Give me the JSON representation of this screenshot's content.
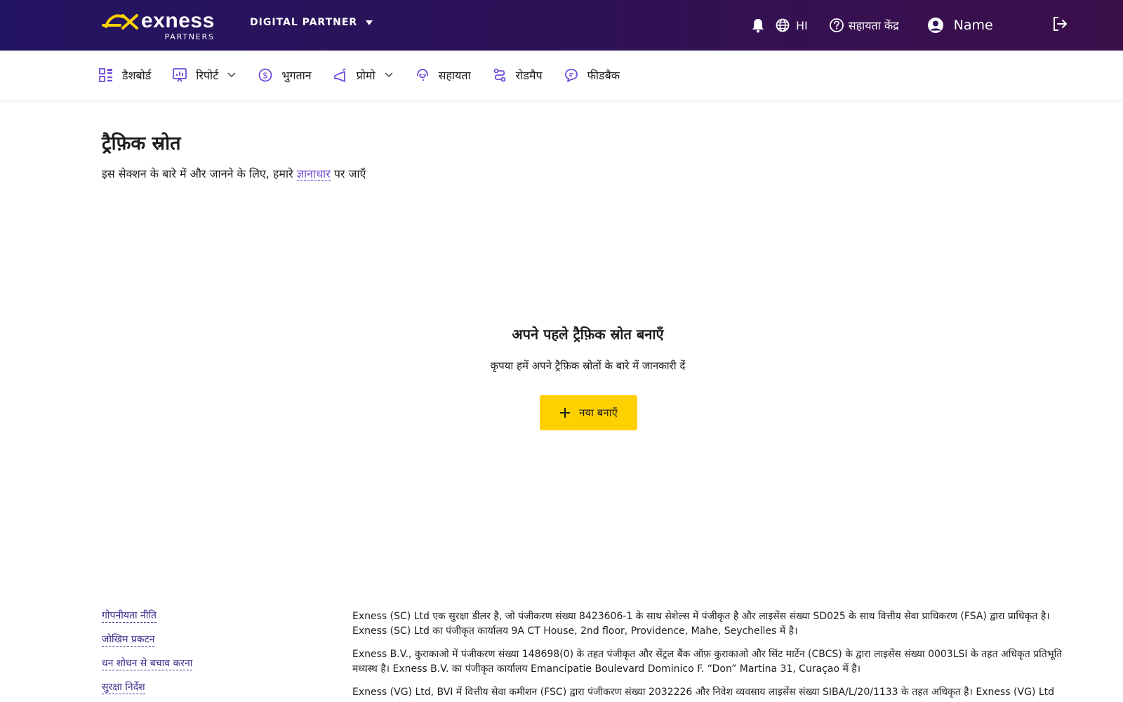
{
  "header": {
    "logo_word": "exness",
    "logo_sub": "PARTNERS",
    "partner_type": "DIGITAL PARTNER",
    "language": "HI",
    "help_center": "सहायता केंद्र",
    "user_name": "Name",
    "colors": {
      "accent": "#ffd000",
      "header_start": "#231462",
      "header_end": "#3b0f4a",
      "logo_mark": "#ffd000"
    }
  },
  "nav": {
    "items": [
      {
        "icon": "dashboard-icon",
        "label": "डैशबोर्ड"
      },
      {
        "icon": "report-icon",
        "label": "रिपोर्ट"
      },
      {
        "icon": "payment-icon",
        "label": "भुगतान"
      },
      {
        "icon": "promo-icon",
        "label": "प्रोमो"
      },
      {
        "icon": "support-icon",
        "label": "सहायता"
      },
      {
        "icon": "roadmap-icon",
        "label": "रोडमैप"
      },
      {
        "icon": "feedback-icon",
        "label": "फीडबैक"
      }
    ]
  },
  "page": {
    "title": "ट्रैफ़िक स्रोत",
    "desc_before": "इस सेक्शन के बारे में और जानने के लिए, हमारे",
    "desc_link": "ज्ञानाधार",
    "desc_after": "पर जाएँ"
  },
  "empty_state": {
    "title": "अपने पहले ट्रैफ़िक स्रोत बनाएँ",
    "subtitle": "कृपया हमें अपने ट्रैफ़िक स्रोतों के बारे में जानकारी दें",
    "button": "नया बनाएँ"
  },
  "footer": {
    "links": [
      "गोपनीयता नीति",
      "जोखिम प्रकटन",
      "धन शोधन से बचाव करना",
      "सुरक्षा निर्देश"
    ],
    "legal": [
      "Exness (SC) Ltd एक सुरक्षा डीलर है, जो पंजीकरण संख्या 8423606-1 के साथ सेशेल्स में पंजीकृत है और लाइसेंस संख्या SD025 के साथ वित्तीय सेवा प्राधिकरण (FSA) द्वारा प्राधिकृत है। Exness (SC) Ltd का पंजीकृत कार्यालय 9A CT House, 2nd floor, Providence, Mahe, Seychelles में है।",
      "Exness B.V., कुराकाओ में पंजीकरण संख्या 148698(0) के तहत पंजीकृत और सेंट्रल बैंक ऑफ़ कुराकाओ और सिंट मार्टेन (CBCS) के द्वारा लाइसेंस संख्या 0003LSI के तहत अधिकृत प्रतिभूति मध्यस्थ है। Exness B.V. का पंजीकृत कार्यालय Emancipatie Boulevard Dominico F. “Don” Martina 31, Curaçao में है।",
      "Exness (VG) Ltd, BVI में वित्तीय सेवा कमीशन (FSC) द्वारा पंजीकरण संख्या 2032226 और निवेश व्यवसाय लाइसेंस संख्या SIBA/L/20/1133 के तहत अधिकृत है। Exness (VG) Ltd"
    ]
  }
}
